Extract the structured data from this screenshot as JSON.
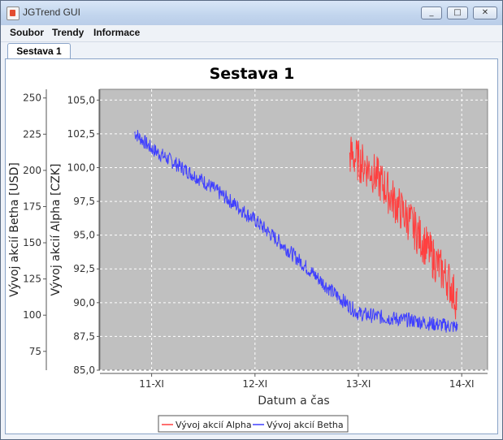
{
  "window": {
    "title": "JGTrend GUI",
    "minimize_glyph": "_",
    "maximize_glyph": "□",
    "close_glyph": "✕"
  },
  "menu": {
    "items": [
      "Soubor",
      "Trendy",
      "Informace"
    ]
  },
  "tabs": [
    {
      "label": "Sestava 1",
      "selected": true
    }
  ],
  "chart_data": {
    "type": "line",
    "title": "Sestava 1",
    "xlabel": "Datum a čas",
    "x_ticks": [
      "11-XI",
      "12-XI",
      "13-XI",
      "14-XI"
    ],
    "xlim": [
      "10-XI 12:00",
      "14-XI 06:00"
    ],
    "left_axes": [
      {
        "label": "Vývoj akcií Betha [USD]",
        "ylim": [
          62,
          256
        ],
        "ticks": [
          "75",
          "100",
          "125",
          "150",
          "175",
          "200",
          "225",
          "250"
        ]
      },
      {
        "label": "Vývoj akcií Alpha [CZK]",
        "ylim": [
          85.0,
          105.8
        ],
        "ticks": [
          "85,0",
          "87,5",
          "90,0",
          "92,5",
          "95,0",
          "97,5",
          "100,0",
          "102,5",
          "105,0"
        ]
      }
    ],
    "plot_background": "#c0c0c0",
    "grid": true,
    "legend_placement": "bottom",
    "series": [
      {
        "name": "Vývoj akcií Alpha",
        "color": "#ff4040",
        "x": [
          "12-XI 22:00",
          "13-XI 03:00",
          "13-XI 06:00",
          "13-XI 09:00",
          "13-XI 12:00",
          "13-XI 15:00",
          "13-XI 18:00",
          "13-XI 21:00",
          "13-XI 23:00"
        ],
        "y": [
          101.0,
          99.8,
          98.6,
          97.2,
          96.0,
          94.5,
          93.0,
          91.6,
          90.0
        ]
      },
      {
        "name": "Vývoj akcií Betha",
        "color": "#4040ff",
        "x": [
          "10-XI 20:00",
          "11-XI 00:00",
          "11-XI 06:00",
          "11-XI 12:00",
          "11-XI 18:00",
          "12-XI 00:00",
          "12-XI 06:00",
          "12-XI 12:00",
          "12-XI 18:00",
          "13-XI 00:00",
          "13-XI 06:00",
          "13-XI 12:00",
          "13-XI 18:00",
          "13-XI 23:00"
        ],
        "y": [
          102.6,
          101.4,
          100.2,
          99.0,
          97.6,
          96.1,
          94.4,
          92.6,
          90.8,
          89.2,
          88.9,
          88.7,
          88.4,
          88.2
        ]
      }
    ]
  }
}
